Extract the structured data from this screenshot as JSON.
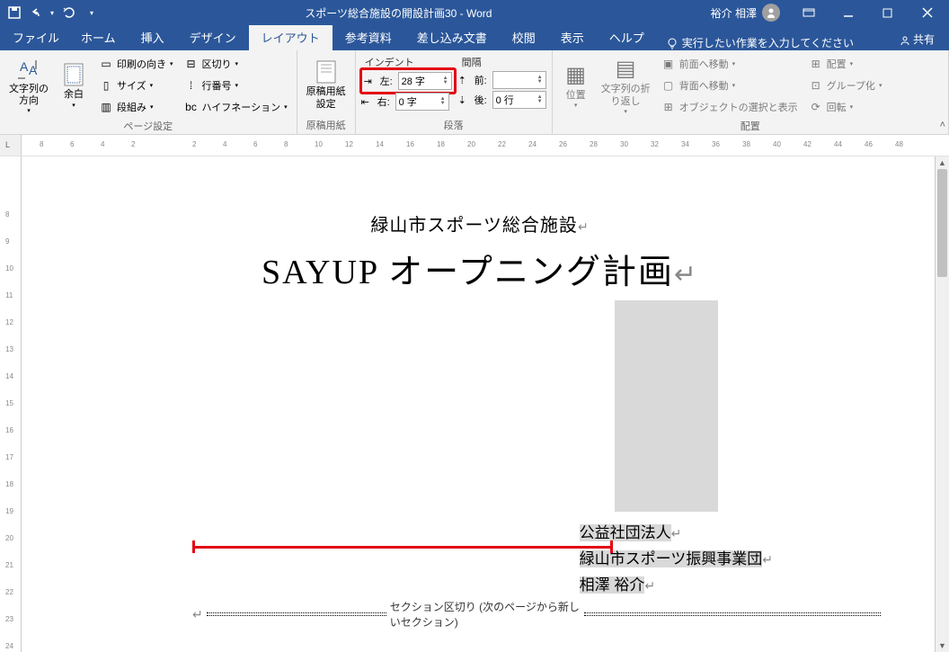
{
  "app": {
    "title": "スポーツ総合施設の開設計画30 - Word",
    "user_name": "裕介 相澤"
  },
  "tabs": {
    "file": "ファイル",
    "home": "ホーム",
    "insert": "挿入",
    "design": "デザイン",
    "layout": "レイアウト",
    "references": "参考資料",
    "mailings": "差し込み文書",
    "review": "校閲",
    "view": "表示",
    "help": "ヘルプ",
    "tellme": "実行したい作業を入力してください",
    "share": "共有"
  },
  "ribbon": {
    "text_direction": "文字列の\n方向",
    "margins": "余白",
    "orientation": "印刷の向き",
    "size": "サイズ",
    "columns": "段組み",
    "breaks": "区切り",
    "line_numbers": "行番号",
    "hyphenation": "ハイフネーション",
    "page_setup_label": "ページ設定",
    "manuscript": "原稿用紙\n設定",
    "manuscript_label": "原稿用紙",
    "indent_label": "インデント",
    "indent_left_label": "左:",
    "indent_left_value": "28 字",
    "indent_right_label": "右:",
    "indent_right_value": "0 字",
    "spacing_label": "間隔",
    "spacing_before_label": "前:",
    "spacing_before_value": "",
    "spacing_after_label": "後:",
    "spacing_after_value": "0 行",
    "paragraph_label": "段落",
    "position": "位置",
    "wrap": "文字列の折\nり返し",
    "bring_forward": "前面へ移動",
    "send_backward": "背面へ移動",
    "selection_pane": "オブジェクトの選択と表示",
    "align": "配置",
    "group": "グループ化",
    "rotate": "回転",
    "arrange_label": "配置"
  },
  "doc": {
    "subtitle": "緑山市スポーツ総合施設",
    "title": "SAYUP オープニング計画",
    "org1": "公益社団法人",
    "org2": "緑山市スポーツ振興事業団",
    "author": "相澤 裕介",
    "section_break": "セクション区切り (次のページから新しいセクション)"
  },
  "ruler_h": [
    "8",
    "6",
    "4",
    "2",
    "",
    "2",
    "4",
    "6",
    "8",
    "10",
    "12",
    "14",
    "16",
    "18",
    "20",
    "22",
    "24",
    "26",
    "28",
    "30",
    "32",
    "34",
    "36",
    "38",
    "40",
    "42",
    "44",
    "46",
    "48"
  ],
  "ruler_v": [
    "",
    "",
    "8",
    "9",
    "10",
    "11",
    "12",
    "13",
    "14",
    "15",
    "16",
    "17",
    "18",
    "19",
    "20",
    "21",
    "22",
    "23",
    "24"
  ]
}
